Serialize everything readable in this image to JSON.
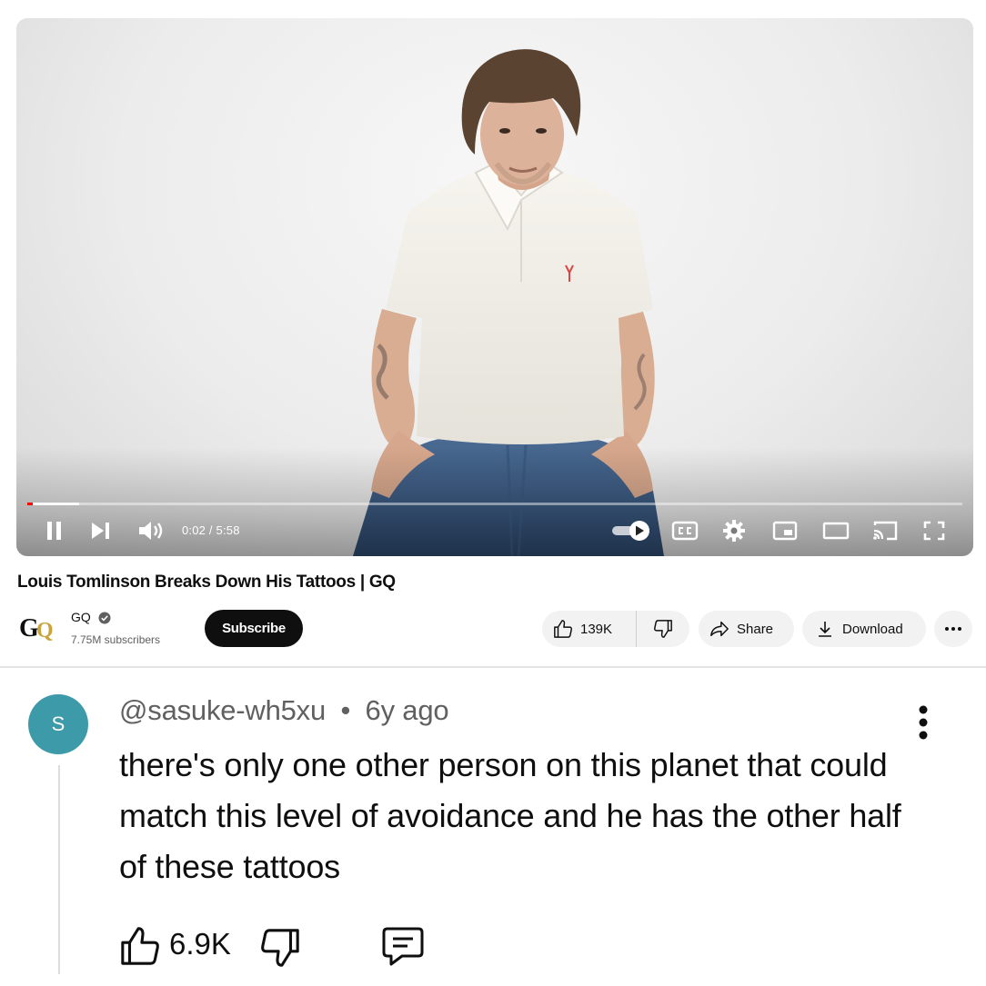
{
  "player": {
    "time_current": "0:02",
    "time_separator": " / ",
    "time_total": "5:58",
    "progress_played": 0.006,
    "progress_buffered": 0.055,
    "autoplay_on": true,
    "accent_color": "#ff0000"
  },
  "video": {
    "title": "Louis Tomlinson Breaks Down His Tattoos | GQ"
  },
  "channel": {
    "logo_text": "GQ",
    "name": "GQ",
    "subscribers": "7.75M subscribers",
    "subscribe_label": "Subscribe"
  },
  "actions": {
    "like_count": "139K",
    "share_label": "Share",
    "download_label": "Download",
    "more_label": "···"
  },
  "comment": {
    "avatar_letter": "S",
    "avatar_color": "#3d9aa9",
    "author": "@sasuke-wh5xu",
    "separator": "•",
    "age": "6y ago",
    "text": "there's only one other person on this planet that could match this level of avoidance and he has the other half of these tattoos",
    "like_count": "6.9K"
  },
  "icons": [
    "pause-icon",
    "next-icon",
    "volume-icon",
    "autoplay-toggle",
    "captions-icon",
    "settings-icon",
    "miniplayer-icon",
    "theater-icon",
    "cast-icon",
    "fullscreen-icon",
    "verified-icon",
    "like-icon",
    "dislike-icon",
    "share-icon",
    "download-icon",
    "more-icon",
    "kebab-icon",
    "reply-icon"
  ]
}
